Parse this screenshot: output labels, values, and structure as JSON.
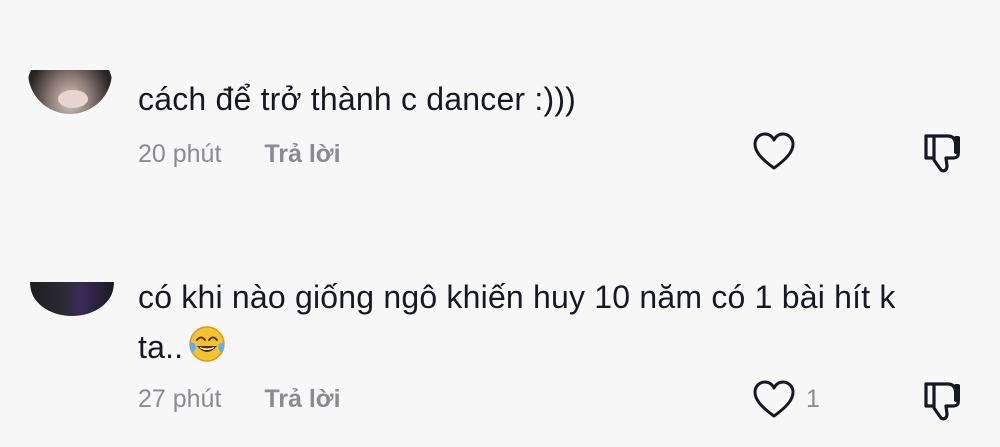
{
  "comments": [
    {
      "text": "cách để trở thành c dancer :)))",
      "time": "20 phút",
      "reply_label": "Trả lời",
      "like_count": ""
    },
    {
      "text": "có khi nào giống ngô khiến huy 10 năm có 1 bài hít k ta..",
      "emoji": "face-with-tears-of-joy",
      "time": "27 phút",
      "reply_label": "Trả lời",
      "like_count": "1"
    }
  ],
  "colors": {
    "text": "#161823",
    "meta": "#8a8b91",
    "background": "#f7f7f7"
  },
  "icons": [
    "heart-icon",
    "thumbs-down-icon",
    "face-with-tears-of-joy"
  ]
}
